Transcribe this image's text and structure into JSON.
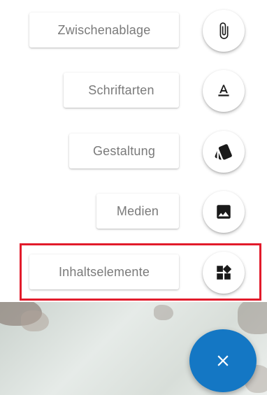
{
  "menu": {
    "items": [
      {
        "label": "Zwischenablage",
        "icon": "paperclip-icon"
      },
      {
        "label": "Schriftarten",
        "icon": "text-format-icon"
      },
      {
        "label": "Gestaltung",
        "icon": "style-cards-icon"
      },
      {
        "label": "Medien",
        "icon": "image-icon"
      },
      {
        "label": "Inhaltselemente",
        "icon": "widgets-icon"
      }
    ],
    "highlighted_item": "Inhaltselemente"
  },
  "fab": {
    "icon": "close-icon",
    "color": "#1477c4"
  },
  "colors": {
    "highlight": "#e21b2b",
    "label_text": "#7a7a7a",
    "icon": "#1a1a1a"
  }
}
